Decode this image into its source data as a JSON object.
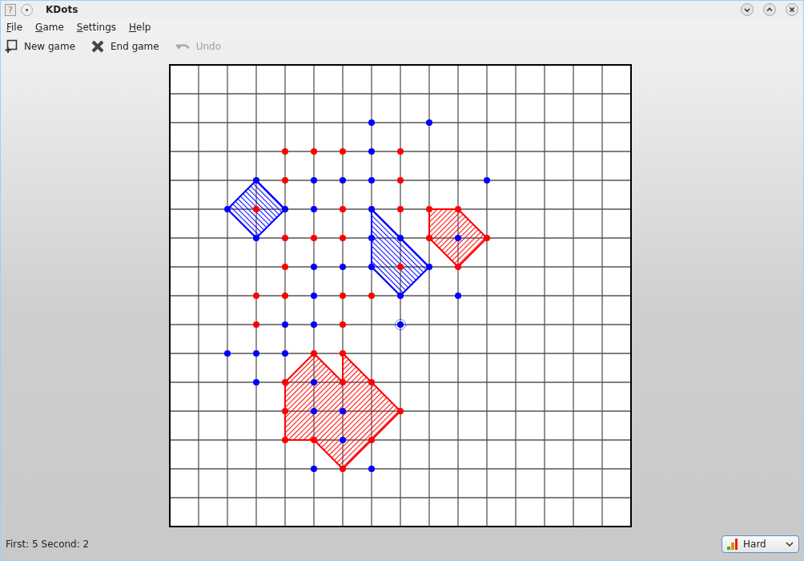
{
  "window": {
    "title": "KDots",
    "help_glyph": "?"
  },
  "menu": [
    "File",
    "Game",
    "Settings",
    "Help"
  ],
  "toolbar": [
    {
      "kind": "new",
      "label": "New game",
      "disabled": false
    },
    {
      "kind": "end",
      "label": "End game",
      "disabled": false
    },
    {
      "kind": "undo",
      "label": "Undo",
      "disabled": true
    }
  ],
  "board": {
    "rows": [
      {
        "cells": [
          {
            "kind": "empty"
          },
          {
            "kind": "empty"
          },
          {
            "kind": "empty"
          },
          {
            "kind": "empty"
          },
          {
            "kind": "empty"
          },
          {
            "kind": "empty"
          },
          {
            "kind": "empty"
          },
          {
            "kind": "empty"
          },
          {
            "kind": "empty"
          },
          {
            "kind": "empty"
          },
          {
            "kind": "empty"
          },
          {
            "kind": "empty"
          },
          {
            "kind": "empty"
          },
          {
            "kind": "empty"
          },
          {
            "kind": "empty"
          },
          {
            "kind": "empty"
          },
          {
            "kind": "empty"
          }
        ]
      },
      {
        "cells": [
          {
            "kind": "empty"
          },
          {
            "kind": "empty"
          },
          {
            "kind": "empty"
          },
          {
            "kind": "empty"
          },
          {
            "kind": "empty"
          },
          {
            "kind": "empty"
          },
          {
            "kind": "empty"
          },
          {
            "kind": "empty"
          },
          {
            "kind": "empty"
          },
          {
            "kind": "empty"
          },
          {
            "kind": "empty"
          },
          {
            "kind": "empty"
          },
          {
            "kind": "empty"
          },
          {
            "kind": "empty"
          },
          {
            "kind": "empty"
          },
          {
            "kind": "empty"
          },
          {
            "kind": "empty"
          }
        ]
      },
      {
        "cells": [
          {
            "kind": "empty"
          },
          {
            "kind": "empty"
          },
          {
            "kind": "empty"
          },
          {
            "kind": "empty"
          },
          {
            "kind": "empty"
          },
          {
            "kind": "empty"
          },
          {
            "kind": "empty"
          },
          {
            "kind": "dot",
            "color": "#0000ff"
          },
          {
            "kind": "empty"
          },
          {
            "kind": "dot",
            "color": "#0000ff"
          },
          {
            "kind": "empty"
          },
          {
            "kind": "empty"
          },
          {
            "kind": "empty"
          },
          {
            "kind": "empty"
          },
          {
            "kind": "empty"
          },
          {
            "kind": "empty"
          },
          {
            "kind": "empty"
          }
        ]
      },
      {
        "cells": [
          {
            "kind": "empty"
          },
          {
            "kind": "empty"
          },
          {
            "kind": "empty"
          },
          {
            "kind": "empty"
          },
          {
            "kind": "dot",
            "color": "#ff0000"
          },
          {
            "kind": "dot",
            "color": "#ff0000"
          },
          {
            "kind": "dot",
            "color": "#ff0000"
          },
          {
            "kind": "dot",
            "color": "#0000ff"
          },
          {
            "kind": "dot",
            "color": "#ff0000"
          },
          {
            "kind": "empty"
          },
          {
            "kind": "empty"
          },
          {
            "kind": "empty"
          },
          {
            "kind": "empty"
          },
          {
            "kind": "empty"
          },
          {
            "kind": "empty"
          },
          {
            "kind": "empty"
          },
          {
            "kind": "empty"
          }
        ]
      },
      {
        "cells": [
          {
            "kind": "empty"
          },
          {
            "kind": "empty"
          },
          {
            "kind": "empty"
          },
          {
            "kind": "dot",
            "color": "#0000ff"
          },
          {
            "kind": "dot",
            "color": "#ff0000"
          },
          {
            "kind": "dot",
            "color": "#0000ff"
          },
          {
            "kind": "dot",
            "color": "#0000ff"
          },
          {
            "kind": "dot",
            "color": "#0000ff"
          },
          {
            "kind": "dot",
            "color": "#ff0000"
          },
          {
            "kind": "empty"
          },
          {
            "kind": "empty"
          },
          {
            "kind": "dot",
            "color": "#0000ff"
          },
          {
            "kind": "empty"
          },
          {
            "kind": "empty"
          },
          {
            "kind": "empty"
          },
          {
            "kind": "empty"
          },
          {
            "kind": "empty"
          }
        ]
      },
      {
        "cells": [
          {
            "kind": "empty"
          },
          {
            "kind": "empty"
          },
          {
            "kind": "dot",
            "color": "#0000ff"
          },
          {
            "kind": "dot",
            "color": "#ff0000"
          },
          {
            "kind": "dot",
            "color": "#0000ff"
          },
          {
            "kind": "dot",
            "color": "#0000ff"
          },
          {
            "kind": "dot",
            "color": "#ff0000"
          },
          {
            "kind": "dot",
            "color": "#0000ff"
          },
          {
            "kind": "dot",
            "color": "#ff0000"
          },
          {
            "kind": "dot",
            "color": "#ff0000"
          },
          {
            "kind": "dot",
            "color": "#ff0000"
          },
          {
            "kind": "empty"
          },
          {
            "kind": "empty"
          },
          {
            "kind": "empty"
          },
          {
            "kind": "empty"
          },
          {
            "kind": "empty"
          },
          {
            "kind": "empty"
          }
        ]
      },
      {
        "cells": [
          {
            "kind": "empty"
          },
          {
            "kind": "empty"
          },
          {
            "kind": "empty"
          },
          {
            "kind": "dot",
            "color": "#0000ff"
          },
          {
            "kind": "dot",
            "color": "#ff0000"
          },
          {
            "kind": "dot",
            "color": "#ff0000"
          },
          {
            "kind": "dot",
            "color": "#ff0000"
          },
          {
            "kind": "dot",
            "color": "#0000ff"
          },
          {
            "kind": "dot",
            "color": "#0000ff"
          },
          {
            "kind": "dot",
            "color": "#ff0000"
          },
          {
            "kind": "dot",
            "color": "#0000ff"
          },
          {
            "kind": "dot",
            "color": "#ff0000"
          },
          {
            "kind": "empty"
          },
          {
            "kind": "empty"
          },
          {
            "kind": "empty"
          },
          {
            "kind": "empty"
          },
          {
            "kind": "empty"
          }
        ]
      },
      {
        "cells": [
          {
            "kind": "empty"
          },
          {
            "kind": "empty"
          },
          {
            "kind": "empty"
          },
          {
            "kind": "empty"
          },
          {
            "kind": "dot",
            "color": "#ff0000"
          },
          {
            "kind": "dot",
            "color": "#0000ff"
          },
          {
            "kind": "dot",
            "color": "#0000ff"
          },
          {
            "kind": "dot",
            "color": "#0000ff"
          },
          {
            "kind": "dot",
            "color": "#ff0000"
          },
          {
            "kind": "dot",
            "color": "#0000ff"
          },
          {
            "kind": "dot",
            "color": "#ff0000"
          },
          {
            "kind": "empty"
          },
          {
            "kind": "empty"
          },
          {
            "kind": "empty"
          },
          {
            "kind": "empty"
          },
          {
            "kind": "empty"
          },
          {
            "kind": "empty"
          }
        ]
      },
      {
        "cells": [
          {
            "kind": "empty"
          },
          {
            "kind": "empty"
          },
          {
            "kind": "empty"
          },
          {
            "kind": "dot",
            "color": "#ff0000"
          },
          {
            "kind": "dot",
            "color": "#ff0000"
          },
          {
            "kind": "dot",
            "color": "#0000ff"
          },
          {
            "kind": "dot",
            "color": "#ff0000"
          },
          {
            "kind": "dot",
            "color": "#ff0000"
          },
          {
            "kind": "dot",
            "color": "#0000ff"
          },
          {
            "kind": "empty"
          },
          {
            "kind": "dot",
            "color": "#0000ff"
          },
          {
            "kind": "empty"
          },
          {
            "kind": "empty"
          },
          {
            "kind": "empty"
          },
          {
            "kind": "empty"
          },
          {
            "kind": "empty"
          },
          {
            "kind": "empty"
          }
        ]
      },
      {
        "cells": [
          {
            "kind": "empty"
          },
          {
            "kind": "empty"
          },
          {
            "kind": "empty"
          },
          {
            "kind": "dot",
            "color": "#ff0000"
          },
          {
            "kind": "dot",
            "color": "#0000ff"
          },
          {
            "kind": "dot",
            "color": "#0000ff"
          },
          {
            "kind": "dot",
            "color": "#ff0000"
          },
          {
            "kind": "empty"
          },
          {
            "kind": "last",
            "color": "#0000ff"
          },
          {
            "kind": "empty"
          },
          {
            "kind": "empty"
          },
          {
            "kind": "empty"
          },
          {
            "kind": "empty"
          },
          {
            "kind": "empty"
          },
          {
            "kind": "empty"
          },
          {
            "kind": "empty"
          },
          {
            "kind": "empty"
          }
        ]
      },
      {
        "cells": [
          {
            "kind": "empty"
          },
          {
            "kind": "empty"
          },
          {
            "kind": "dot",
            "color": "#0000ff"
          },
          {
            "kind": "dot",
            "color": "#0000ff"
          },
          {
            "kind": "dot",
            "color": "#0000ff"
          },
          {
            "kind": "dot",
            "color": "#ff0000"
          },
          {
            "kind": "dot",
            "color": "#ff0000"
          },
          {
            "kind": "empty"
          },
          {
            "kind": "empty"
          },
          {
            "kind": "empty"
          },
          {
            "kind": "empty"
          },
          {
            "kind": "empty"
          },
          {
            "kind": "empty"
          },
          {
            "kind": "empty"
          },
          {
            "kind": "empty"
          },
          {
            "kind": "empty"
          },
          {
            "kind": "empty"
          }
        ]
      },
      {
        "cells": [
          {
            "kind": "empty"
          },
          {
            "kind": "empty"
          },
          {
            "kind": "empty"
          },
          {
            "kind": "dot",
            "color": "#0000ff"
          },
          {
            "kind": "dot",
            "color": "#ff0000"
          },
          {
            "kind": "dot",
            "color": "#0000ff"
          },
          {
            "kind": "dot",
            "color": "#ff0000"
          },
          {
            "kind": "dot",
            "color": "#ff0000"
          },
          {
            "kind": "empty"
          },
          {
            "kind": "empty"
          },
          {
            "kind": "empty"
          },
          {
            "kind": "empty"
          },
          {
            "kind": "empty"
          },
          {
            "kind": "empty"
          },
          {
            "kind": "empty"
          },
          {
            "kind": "empty"
          },
          {
            "kind": "empty"
          }
        ]
      },
      {
        "cells": [
          {
            "kind": "empty"
          },
          {
            "kind": "empty"
          },
          {
            "kind": "empty"
          },
          {
            "kind": "empty"
          },
          {
            "kind": "dot",
            "color": "#ff0000"
          },
          {
            "kind": "dot",
            "color": "#0000ff"
          },
          {
            "kind": "dot",
            "color": "#0000ff"
          },
          {
            "kind": "empty"
          },
          {
            "kind": "dot",
            "color": "#ff0000"
          },
          {
            "kind": "empty"
          },
          {
            "kind": "empty"
          },
          {
            "kind": "empty"
          },
          {
            "kind": "empty"
          },
          {
            "kind": "empty"
          },
          {
            "kind": "empty"
          },
          {
            "kind": "empty"
          },
          {
            "kind": "empty"
          }
        ]
      },
      {
        "cells": [
          {
            "kind": "empty"
          },
          {
            "kind": "empty"
          },
          {
            "kind": "empty"
          },
          {
            "kind": "empty"
          },
          {
            "kind": "dot",
            "color": "#ff0000"
          },
          {
            "kind": "dot",
            "color": "#ff0000"
          },
          {
            "kind": "dot",
            "color": "#0000ff"
          },
          {
            "kind": "dot",
            "color": "#ff0000"
          },
          {
            "kind": "empty"
          },
          {
            "kind": "empty"
          },
          {
            "kind": "empty"
          },
          {
            "kind": "empty"
          },
          {
            "kind": "empty"
          },
          {
            "kind": "empty"
          },
          {
            "kind": "empty"
          },
          {
            "kind": "empty"
          },
          {
            "kind": "empty"
          }
        ]
      },
      {
        "cells": [
          {
            "kind": "empty"
          },
          {
            "kind": "empty"
          },
          {
            "kind": "empty"
          },
          {
            "kind": "empty"
          },
          {
            "kind": "empty"
          },
          {
            "kind": "dot",
            "color": "#0000ff"
          },
          {
            "kind": "dot",
            "color": "#ff0000"
          },
          {
            "kind": "dot",
            "color": "#0000ff"
          },
          {
            "kind": "empty"
          },
          {
            "kind": "empty"
          },
          {
            "kind": "empty"
          },
          {
            "kind": "empty"
          },
          {
            "kind": "empty"
          },
          {
            "kind": "empty"
          },
          {
            "kind": "empty"
          },
          {
            "kind": "empty"
          },
          {
            "kind": "empty"
          }
        ]
      },
      {
        "cells": [
          {
            "kind": "empty"
          },
          {
            "kind": "empty"
          },
          {
            "kind": "empty"
          },
          {
            "kind": "empty"
          },
          {
            "kind": "empty"
          },
          {
            "kind": "empty"
          },
          {
            "kind": "empty"
          },
          {
            "kind": "empty"
          },
          {
            "kind": "empty"
          },
          {
            "kind": "empty"
          },
          {
            "kind": "empty"
          },
          {
            "kind": "empty"
          },
          {
            "kind": "empty"
          },
          {
            "kind": "empty"
          },
          {
            "kind": "empty"
          },
          {
            "kind": "empty"
          },
          {
            "kind": "empty"
          }
        ]
      },
      {
        "cells": [
          {
            "kind": "empty"
          },
          {
            "kind": "empty"
          },
          {
            "kind": "empty"
          },
          {
            "kind": "empty"
          },
          {
            "kind": "empty"
          },
          {
            "kind": "empty"
          },
          {
            "kind": "empty"
          },
          {
            "kind": "empty"
          },
          {
            "kind": "empty"
          },
          {
            "kind": "empty"
          },
          {
            "kind": "empty"
          },
          {
            "kind": "empty"
          },
          {
            "kind": "empty"
          },
          {
            "kind": "empty"
          },
          {
            "kind": "empty"
          },
          {
            "kind": "empty"
          },
          {
            "kind": "empty"
          }
        ]
      }
    ]
  },
  "status_bar": {
    "score": "First: 5 Second: 2",
    "difficulty": "Hard"
  }
}
